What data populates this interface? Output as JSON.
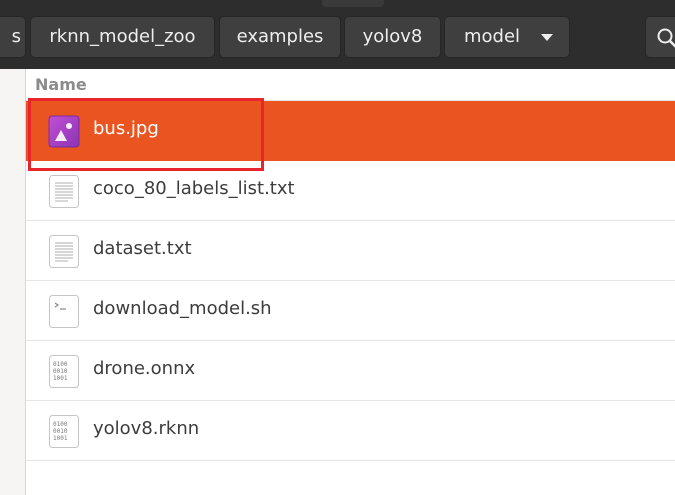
{
  "path_bar": {
    "crumbs": [
      "s",
      "rknn_model_zoo",
      "examples",
      "yolov8",
      "model"
    ]
  },
  "file_list": {
    "column_header": "Name",
    "files": [
      {
        "name": "bus.jpg",
        "icon": "image-file-icon",
        "selected": true
      },
      {
        "name": "coco_80_labels_list.txt",
        "icon": "text-file-icon",
        "selected": false
      },
      {
        "name": "dataset.txt",
        "icon": "text-file-icon",
        "selected": false
      },
      {
        "name": "download_model.sh",
        "icon": "script-file-icon",
        "selected": false
      },
      {
        "name": "drone.onnx",
        "icon": "binary-file-icon",
        "selected": false
      },
      {
        "name": "yolov8.rknn",
        "icon": "binary-file-icon",
        "selected": false
      }
    ]
  },
  "colors": {
    "selection": "#e95420",
    "annotation_box": "#e8242c",
    "header_bg": "#2d2d2d"
  }
}
